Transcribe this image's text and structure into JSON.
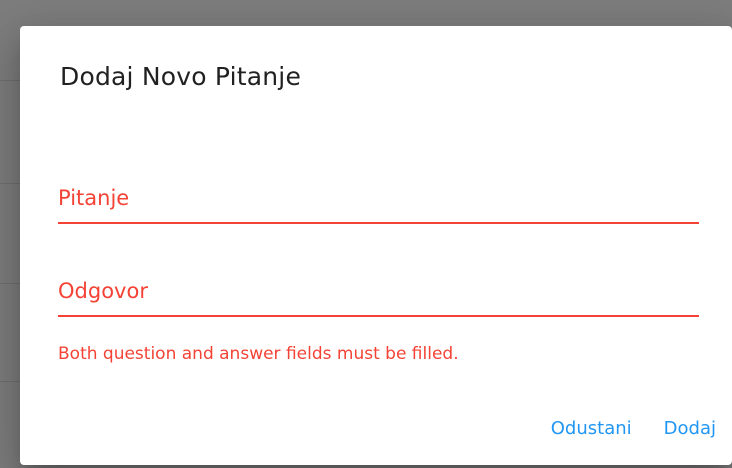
{
  "dialog": {
    "title": "Dodaj Novo Pitanje",
    "question_field": {
      "label": "Pitanje",
      "value": ""
    },
    "answer_field": {
      "label": "Odgovor",
      "value": ""
    },
    "error_message": "Both question and answer fields must be filled.",
    "buttons": {
      "cancel_label": "Odustani",
      "add_label": "Dodaj"
    }
  },
  "colors": {
    "error": "#f44336",
    "action": "#2196f3",
    "backdrop": "#7d7d7d"
  }
}
